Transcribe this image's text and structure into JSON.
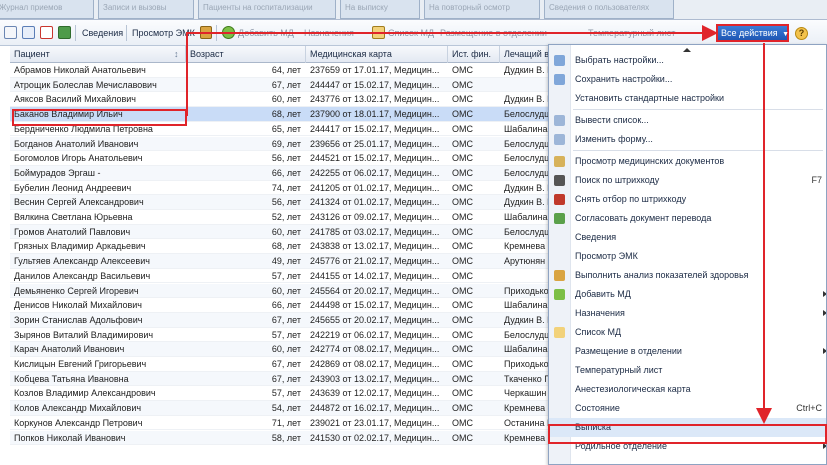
{
  "tabs": [
    {
      "label": "Журнал приемов"
    },
    {
      "label": "Записи и вызовы"
    },
    {
      "label": "Пациенты на госпитализации"
    },
    {
      "label": "На выписку"
    },
    {
      "label": "На повторный осмотр"
    },
    {
      "label": "Сведения о пользователях"
    }
  ],
  "toolbar": {
    "info": "Сведения",
    "view_emk": "Просмотр ЭМК",
    "add_md": "Добавить МД",
    "appointments": "Назначения",
    "md_list": "Список МД",
    "placement": "Размещение в отделении",
    "temp_sheet": "Температурный лист",
    "all_actions": "Все действия",
    "help": "?"
  },
  "columns": {
    "patient": "Пациент",
    "age": "Возраст",
    "card": "Медицинская карта",
    "fin": "Ист. фин.",
    "doctor": "Лечащий вра"
  },
  "rows": [
    {
      "patient": "Абрамов Николай Анатольевич",
      "age": "64, лет",
      "card": "237659 от 17.01.17, Медицин...",
      "fin": "ОМС",
      "doctor": "Дудкин В. Н."
    },
    {
      "patient": "Атрощик Болеслав Мечиславович",
      "age": "67, лет",
      "card": "244447 от 15.02.17, Медицин...",
      "fin": "ОМС",
      "doctor": ""
    },
    {
      "patient": "Аяксов Василий Михайлович",
      "age": "60, лет",
      "card": "243776 от 13.02.17, Медицин...",
      "fin": "ОМС",
      "doctor": "Дудкин В. Н."
    },
    {
      "patient": "Баканов Владимир Ильич",
      "age": "68, лет",
      "card": "237900 от 18.01.17, Медицин...",
      "fin": "ОМС",
      "doctor": "Белослудце"
    },
    {
      "patient": "Бердниченко Людмила Петровна",
      "age": "65, лет",
      "card": "244417 от 15.02.17, Медицин...",
      "fin": "ОМС",
      "doctor": "Шабалина М."
    },
    {
      "patient": "Богданов Анатолий Иванович",
      "age": "69, лет",
      "card": "239656 от 25.01.17, Медицин...",
      "fin": "ОМС",
      "doctor": "Белослудце"
    },
    {
      "patient": "Богомолов Игорь Анатольевич",
      "age": "56, лет",
      "card": "244521 от 15.02.17, Медицин...",
      "fin": "ОМС",
      "doctor": "Белослудце"
    },
    {
      "patient": "Боймурадов Эргаш -",
      "age": "66, лет",
      "card": "242255 от 06.02.17, Медицин...",
      "fin": "ОМС",
      "doctor": "Белослудце"
    },
    {
      "patient": "Бубелин Леонид Андреевич",
      "age": "74, лет",
      "card": "241205 от 01.02.17, Медицин...",
      "fin": "ОМС",
      "doctor": "Дудкин В. Н."
    },
    {
      "patient": "Веснин Сергей Александрович",
      "age": "56, лет",
      "card": "241324 от 01.02.17, Медицин...",
      "fin": "ОМС",
      "doctor": "Дудкин В. Н."
    },
    {
      "patient": "Вялкина Светлана Юрьевна",
      "age": "52, лет",
      "card": "243126 от 09.02.17, Медицин...",
      "fin": "ОМС",
      "doctor": "Шабалина М."
    },
    {
      "patient": "Громов Анатолий Павлович",
      "age": "60, лет",
      "card": "241785 от 03.02.17, Медицин...",
      "fin": "ОМС",
      "doctor": "Белослудце"
    },
    {
      "patient": "Грязных Владимир Аркадьевич",
      "age": "68, лет",
      "card": "243838 от 13.02.17, Медицин...",
      "fin": "ОМС",
      "doctor": "Кремнева П."
    },
    {
      "patient": "Гультяев Александр Алексеевич",
      "age": "49, лет",
      "card": "245776 от 21.02.17, Медицин...",
      "fin": "ОМС",
      "doctor": "Арутюнян П."
    },
    {
      "patient": "Данилов Александр Васильевич",
      "age": "57, лет",
      "card": "244155 от 14.02.17, Медицин...",
      "fin": "ОМС",
      "doctor": ""
    },
    {
      "patient": "Демьяненко Сергей Игоревич",
      "age": "60, лет",
      "card": "245564 от 20.02.17, Медицин...",
      "fin": "ОМС",
      "doctor": "Приходько В"
    },
    {
      "patient": "Денисов Николай Михайлович",
      "age": "66, лет",
      "card": "244498 от 15.02.17, Медицин...",
      "fin": "ОМС",
      "doctor": "Шабалина М."
    },
    {
      "patient": "Зорин Станислав Адольфович",
      "age": "67, лет",
      "card": "245655 от 20.02.17, Медицин...",
      "fin": "ОМС",
      "doctor": "Дудкин В. Н."
    },
    {
      "patient": "Зырянов Виталий Владимирович",
      "age": "57, лет",
      "card": "242219 от 06.02.17, Медицин...",
      "fin": "ОМС",
      "doctor": "Белослудце"
    },
    {
      "patient": "Карач Анатолий Иванович",
      "age": "60, лет",
      "card": "242774 от 08.02.17, Медицин...",
      "fin": "ОМС",
      "doctor": "Шабалина М."
    },
    {
      "patient": "Кислицын Евгений Григорьевич",
      "age": "67, лет",
      "card": "242869 от 08.02.17, Медицин...",
      "fin": "ОМС",
      "doctor": "Приходько В"
    },
    {
      "patient": "Кобцева Татьяна Ивановна",
      "age": "67, лет",
      "card": "243903 от 13.02.17, Медицин...",
      "fin": "ОМС",
      "doctor": "Ткаченко Г."
    },
    {
      "patient": "Козлов Владимир Александрович",
      "age": "57, лет",
      "card": "243639 от 12.02.17, Медицин...",
      "fin": "ОМС",
      "doctor": "Черкашин А."
    },
    {
      "patient": "Колов Александр Михайлович",
      "age": "54, лет",
      "card": "244872 от 16.02.17, Медицин...",
      "fin": "ОМС",
      "doctor": "Кремнева П."
    },
    {
      "patient": "Коркунов Александр Петрович",
      "age": "71, лет",
      "card": "239021 от 23.01.17, Медицин...",
      "fin": "ОМС",
      "doctor": "Останина В."
    },
    {
      "patient": "Попков Николай Иванович",
      "age": "58, лет",
      "card": "241530 от 02.02.17, Медицин...",
      "fin": "ОМС",
      "doctor": "Кремнева П."
    }
  ],
  "menu": {
    "items": [
      {
        "label": "Выбрать настройки...",
        "icon": "settings-select-icon",
        "shortcut": "",
        "submenu": false
      },
      {
        "label": "Сохранить настройки...",
        "icon": "settings-save-icon",
        "shortcut": "",
        "submenu": false
      },
      {
        "label": "Установить стандартные настройки",
        "icon": "",
        "shortcut": "",
        "submenu": false
      },
      {
        "label": "Вывести список...",
        "icon": "list-output-icon",
        "shortcut": "",
        "submenu": false
      },
      {
        "label": "Изменить форму...",
        "icon": "form-edit-icon",
        "shortcut": "",
        "submenu": false
      },
      {
        "label": "Просмотр медицинских документов",
        "icon": "documents-icon",
        "shortcut": "",
        "submenu": false
      },
      {
        "label": "Поиск по штрихкоду",
        "icon": "barcode-icon",
        "shortcut": "F7",
        "submenu": false
      },
      {
        "label": "Снять отбор по штрихкоду",
        "icon": "barcode-clear-icon",
        "shortcut": "",
        "submenu": false
      },
      {
        "label": "Согласовать документ перевода",
        "icon": "approve-icon",
        "shortcut": "",
        "submenu": false
      },
      {
        "label": "Сведения",
        "icon": "",
        "shortcut": "",
        "submenu": false
      },
      {
        "label": "Просмотр ЭМК",
        "icon": "",
        "shortcut": "",
        "submenu": false
      },
      {
        "label": "Выполнить анализ показателей здоровья",
        "icon": "chart-icon",
        "shortcut": "",
        "submenu": false
      },
      {
        "label": "Добавить МД",
        "icon": "add-icon",
        "shortcut": "",
        "submenu": true
      },
      {
        "label": "Назначения",
        "icon": "",
        "shortcut": "",
        "submenu": true
      },
      {
        "label": "Список МД",
        "icon": "folder-icon",
        "shortcut": "",
        "submenu": false
      },
      {
        "label": "Размещение в отделении",
        "icon": "",
        "shortcut": "",
        "submenu": true
      },
      {
        "label": "Температурный лист",
        "icon": "",
        "shortcut": "",
        "submenu": false
      },
      {
        "label": "Анестезиологическая карта",
        "icon": "",
        "shortcut": "",
        "submenu": false
      },
      {
        "label": "Состояние",
        "icon": "",
        "shortcut": "Ctrl+C",
        "submenu": false
      },
      {
        "label": "Выписка",
        "icon": "",
        "shortcut": "",
        "submenu": false
      },
      {
        "label": "Родильное отделение",
        "icon": "",
        "shortcut": "",
        "submenu": true
      }
    ]
  },
  "colors": {
    "annotation_red": "#e0242a",
    "selection_row": "#c9dcf7",
    "accent_blue": "#2a62c0"
  }
}
